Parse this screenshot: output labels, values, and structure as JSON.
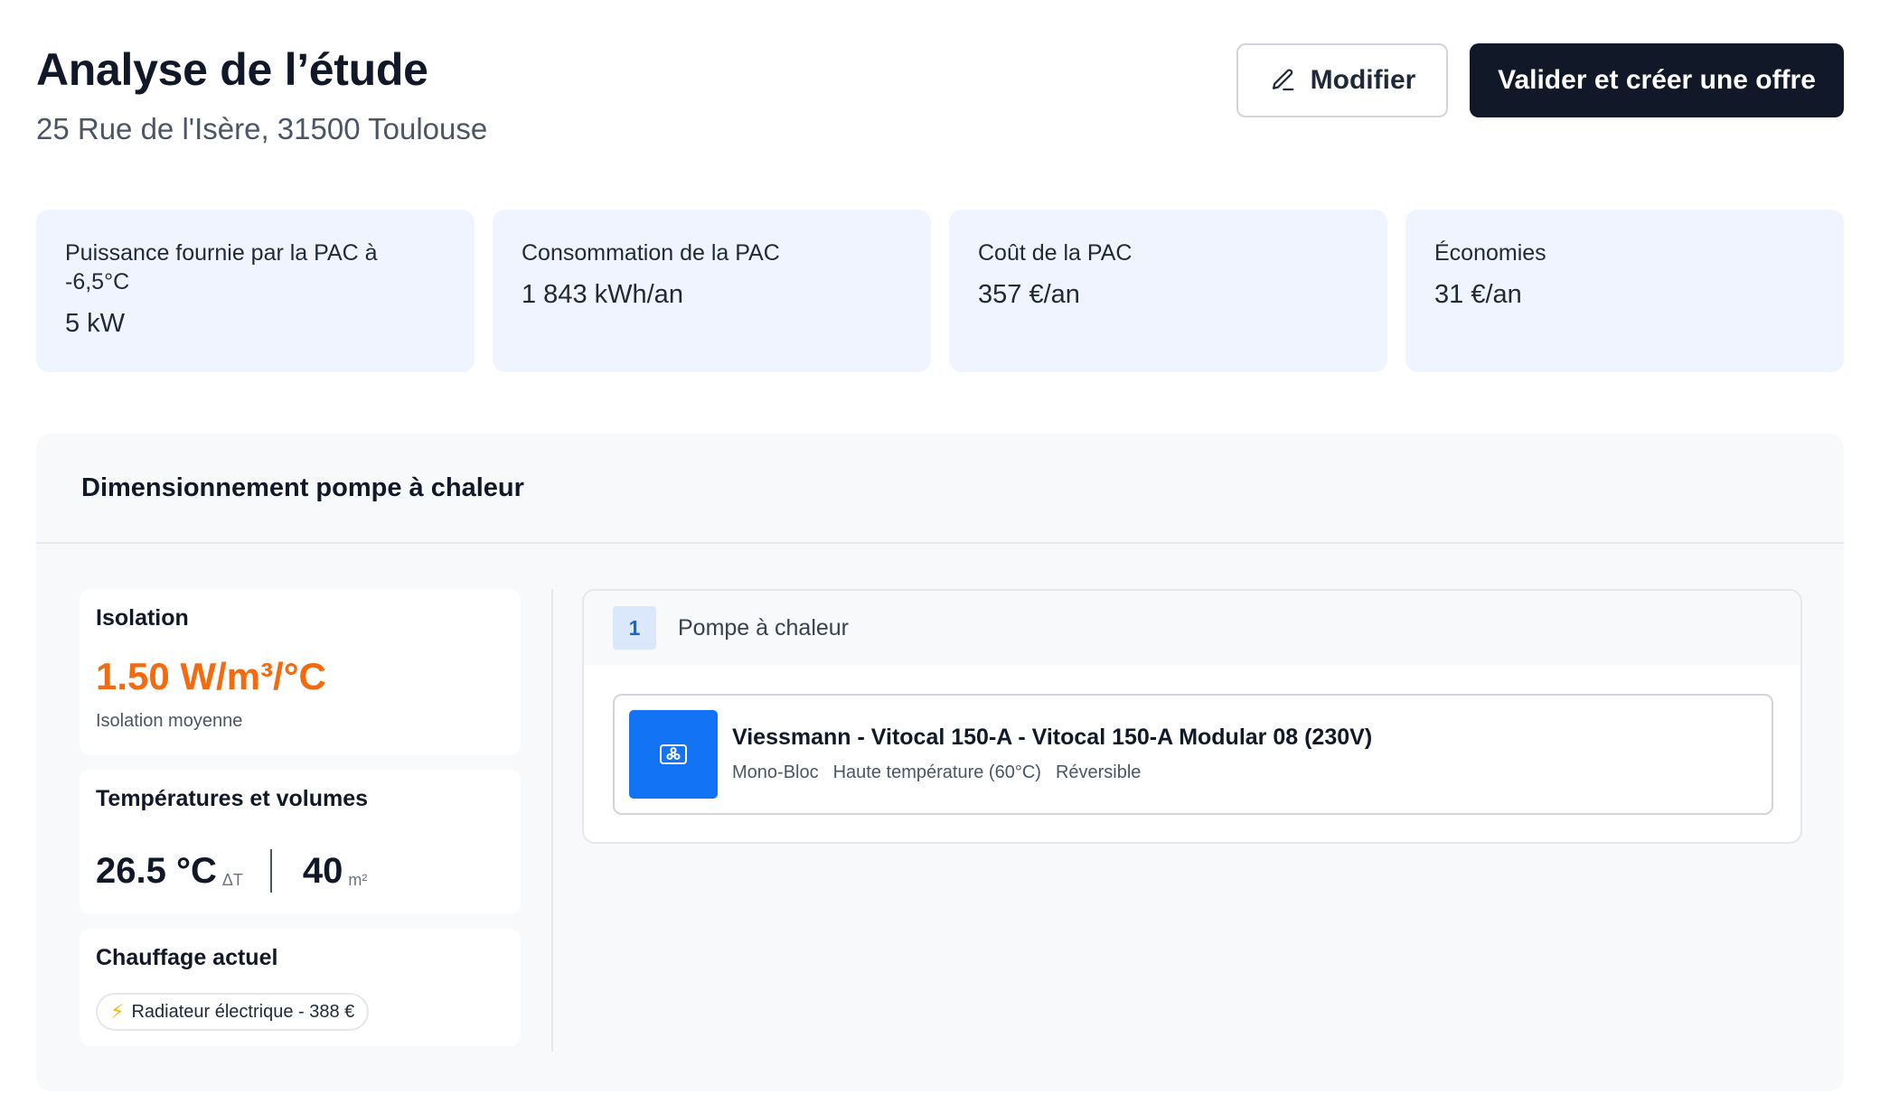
{
  "header": {
    "title": "Analyse de l’étude",
    "address": "25 Rue de l'Isère, 31500 Toulouse",
    "edit_label": "Modifier",
    "validate_label": "Valider et créer une offre"
  },
  "stats": [
    {
      "label": "Puissance fournie par la PAC à -6,5°C",
      "value": "5 kW"
    },
    {
      "label": "Consommation de la PAC",
      "value": "1 843 kWh/an"
    },
    {
      "label": "Coût de la PAC",
      "value": "357 €/an"
    },
    {
      "label": "Économies",
      "value": "31 €/an"
    }
  ],
  "section": {
    "title": "Dimensionnement pompe à chaleur"
  },
  "isolation": {
    "title": "Isolation",
    "value": "1.50 W/m³/°C",
    "subtitle": "Isolation moyenne",
    "color": "#f46a0e"
  },
  "temperatures": {
    "title": "Températures et volumes",
    "delta_value": "26.5 °C",
    "delta_unit": "ΔT",
    "area_value": "40",
    "area_unit": "m²"
  },
  "heating": {
    "title": "Chauffage actuel",
    "pill": "Radiateur électrique - 388 €",
    "icon": "lightning-icon"
  },
  "heat_pumps": {
    "index": "1",
    "title": "Pompe à chaleur",
    "product": {
      "name": "Viessmann - Vitocal 150-A - Vitocal 150-A Modular 08 (230V)",
      "tags": [
        "Mono-Bloc",
        "Haute température (60°C)",
        "Réversible"
      ],
      "icon": "heat-pump-icon",
      "icon_bg": "#1373f5"
    }
  },
  "colors": {
    "primary_dark": "#111827",
    "stat_bg": "#eff4ff",
    "accent_orange": "#f46a0e",
    "accent_blue": "#1373f5"
  }
}
